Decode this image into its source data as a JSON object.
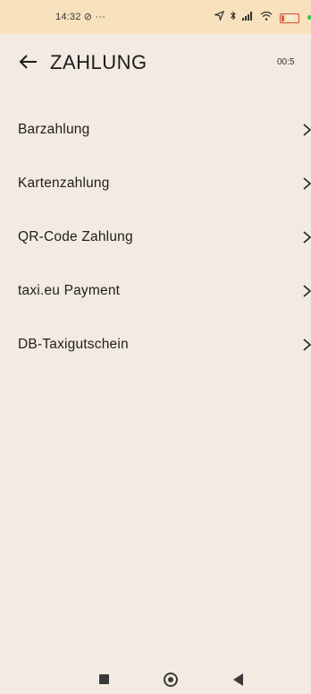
{
  "status_bar": {
    "time": "14:32",
    "extra_icons": "⊘ ···",
    "battery_level": "19",
    "battery_fraction": 0.19,
    "icons": [
      "location-arrow-icon",
      "bluetooth-icon",
      "signal-icon",
      "wifi-icon",
      "battery-icon"
    ]
  },
  "header": {
    "title": "ZAHLUNG",
    "timer": "00:5"
  },
  "payment_options": [
    {
      "label": "Barzahlung"
    },
    {
      "label": "Kartenzahlung"
    },
    {
      "label": "QR-Code Zahlung"
    },
    {
      "label": "taxi.eu Payment"
    },
    {
      "label": "DB-Taxigutschein"
    }
  ],
  "colors": {
    "background": "#f3ebe2",
    "status_bar": "#f7e2bd",
    "battery": "#e15a44",
    "indicator_dot": "#3cc24a"
  }
}
